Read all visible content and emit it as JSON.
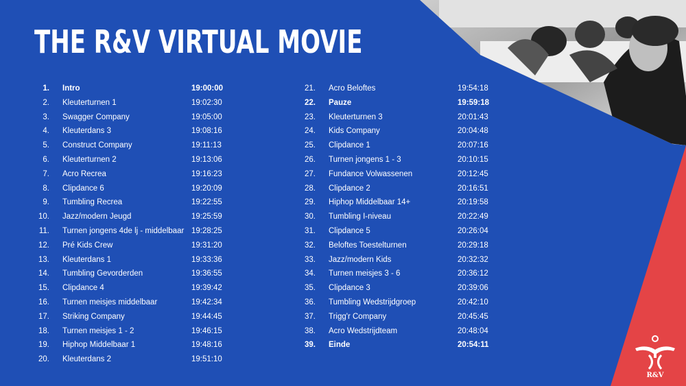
{
  "title": "THE R&V VIRTUAL MOVIE",
  "colors": {
    "blue": "#1f4fb5",
    "red": "#e44446",
    "white": "#ffffff"
  },
  "logo_text": "R&V",
  "schedule_left": [
    {
      "num": "1.",
      "name": "Intro",
      "time": "19:00:00",
      "bold": true
    },
    {
      "num": "2.",
      "name": "Kleuterturnen 1",
      "time": "19:02:30"
    },
    {
      "num": "3.",
      "name": "Swagger Company",
      "time": "19:05:00"
    },
    {
      "num": "4.",
      "name": "Kleuterdans 3",
      "time": "19:08:16"
    },
    {
      "num": "5.",
      "name": "Construct Company",
      "time": "19:11:13"
    },
    {
      "num": "6.",
      "name": "Kleuterturnen 2",
      "time": "19:13:06"
    },
    {
      "num": "7.",
      "name": "Acro Recrea",
      "time": "19:16:23"
    },
    {
      "num": "8.",
      "name": "Clipdance 6",
      "time": "19:20:09"
    },
    {
      "num": "9.",
      "name": "Tumbling Recrea",
      "time": "19:22:55"
    },
    {
      "num": "10.",
      "name": "Jazz/modern Jeugd",
      "time": "19:25:59"
    },
    {
      "num": "11.",
      "name": "Turnen jongens 4de lj - middelbaar",
      "time": "19:28:25"
    },
    {
      "num": "12.",
      "name": "Pré Kids Crew",
      "time": "19:31:20"
    },
    {
      "num": "13.",
      "name": "Kleuterdans 1",
      "time": "19:33:36"
    },
    {
      "num": "14.",
      "name": "Tumbling Gevorderden",
      "time": "19:36:55"
    },
    {
      "num": "15.",
      "name": "Clipdance 4",
      "time": "19:39:42"
    },
    {
      "num": "16.",
      "name": "Turnen meisjes middelbaar",
      "time": "19:42:34"
    },
    {
      "num": "17.",
      "name": "Striking Company",
      "time": "19:44:45"
    },
    {
      "num": "18.",
      "name": "Turnen meisjes 1 - 2",
      "time": "19:46:15"
    },
    {
      "num": "19.",
      "name": "Hiphop Middelbaar 1",
      "time": "19:48:16"
    },
    {
      "num": "20.",
      "name": "Kleuterdans 2",
      "time": "19:51:10"
    }
  ],
  "schedule_right": [
    {
      "num": "21.",
      "name": "Acro Beloftes",
      "time": "19:54:18"
    },
    {
      "num": "22.",
      "name": "Pauze",
      "time": "19:59:18",
      "bold": true
    },
    {
      "num": "23.",
      "name": "Kleuterturnen 3",
      "time": "20:01:43"
    },
    {
      "num": "24.",
      "name": "Kids Company",
      "time": "20:04:48"
    },
    {
      "num": "25.",
      "name": "Clipdance 1",
      "time": "20:07:16"
    },
    {
      "num": "26.",
      "name": "Turnen jongens 1 - 3",
      "time": "20:10:15"
    },
    {
      "num": "27.",
      "name": "Fundance Volwassenen",
      "time": "20:12:45"
    },
    {
      "num": "28.",
      "name": "Clipdance 2",
      "time": "20:16:51"
    },
    {
      "num": "29.",
      "name": "Hiphop Middelbaar 14+",
      "time": "20:19:58"
    },
    {
      "num": "30.",
      "name": "Tumbling I-niveau",
      "time": "20:22:49"
    },
    {
      "num": "31.",
      "name": "Clipdance 5",
      "time": "20:26:04"
    },
    {
      "num": "32.",
      "name": "Beloftes Toestelturnen",
      "time": "20:29:18"
    },
    {
      "num": "33.",
      "name": "Jazz/modern Kids",
      "time": "20:32:32"
    },
    {
      "num": "34.",
      "name": "Turnen meisjes 3 - 6",
      "time": "20:36:12"
    },
    {
      "num": "35.",
      "name": "Clipdance 3",
      "time": "20:39:06"
    },
    {
      "num": "36.",
      "name": "Tumbling Wedstrijdgroep",
      "time": "20:42:10"
    },
    {
      "num": "37.",
      "name": "Trigg'r Company",
      "time": "20:45:45"
    },
    {
      "num": "38.",
      "name": "Acro Wedstrijdteam",
      "time": "20:48:04"
    },
    {
      "num": "39.",
      "name": "Einde",
      "time": "20:54:11",
      "bold": true
    }
  ]
}
